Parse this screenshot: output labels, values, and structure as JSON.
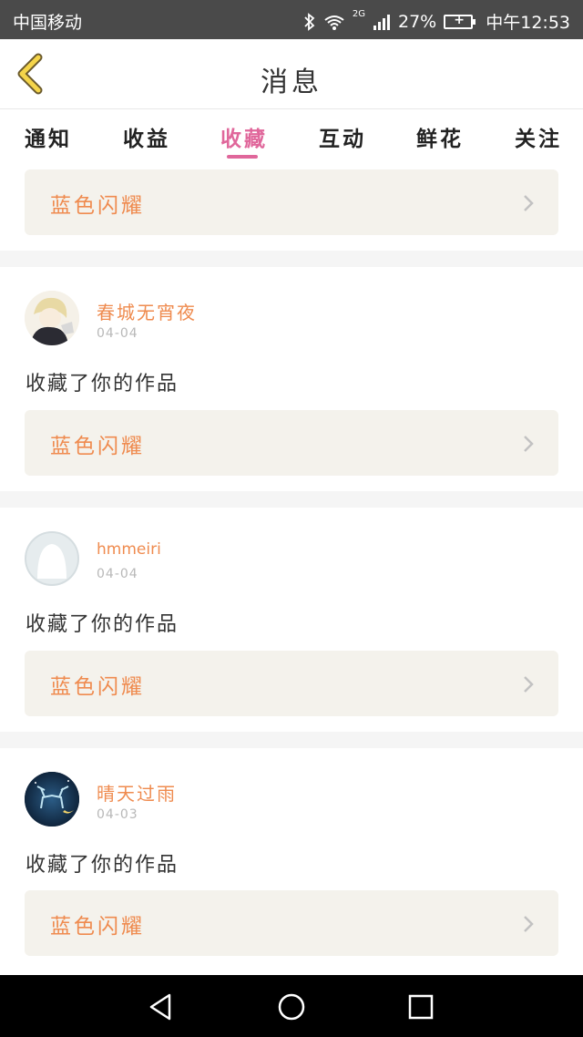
{
  "status_bar": {
    "carrier": "中国移动",
    "network": "2G",
    "battery": "27%",
    "time": "中午12:53",
    "icons": [
      "bluetooth-icon",
      "wifi-icon",
      "signal-icon",
      "battery-icon"
    ]
  },
  "header": {
    "title": "消息",
    "back_icon": "chevron-left-icon"
  },
  "tabs": [
    {
      "label": "通知",
      "active": false
    },
    {
      "label": "收益",
      "active": false
    },
    {
      "label": "收藏",
      "active": true
    },
    {
      "label": "互动",
      "active": false
    },
    {
      "label": "鲜花",
      "active": false
    },
    {
      "label": "关注",
      "active": false
    }
  ],
  "partial_item": {
    "work_title": "蓝色闪耀"
  },
  "items": [
    {
      "username": "春城无宵夜",
      "date": "04-04",
      "action": "收藏了你的作品",
      "work_title": "蓝色闪耀",
      "avatar": "anime-boy-avatar"
    },
    {
      "username": "hmmeiri",
      "date": "04-04",
      "action": "收藏了你的作品",
      "work_title": "蓝色闪耀",
      "avatar": "default-user-avatar"
    },
    {
      "username": "晴天过雨",
      "date": "04-03",
      "action": "收藏了你的作品",
      "work_title": "蓝色闪耀",
      "avatar": "deer-night-avatar"
    }
  ],
  "colors": {
    "accent_pink": "#e0679b",
    "accent_orange": "#ef8b4f",
    "card_bg": "#f4f2ec",
    "status_bar_bg": "#4a4a4a",
    "nav_bar_bg": "#000000"
  }
}
